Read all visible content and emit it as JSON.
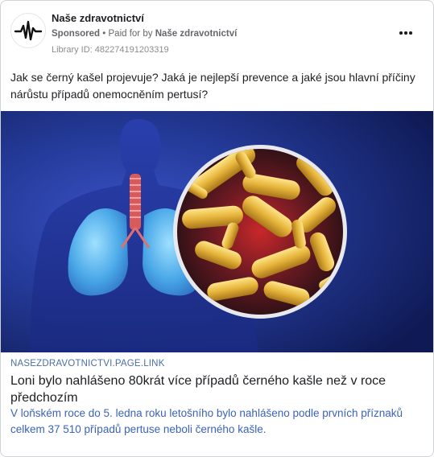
{
  "ad": {
    "page_name": "Naše zdravotnictví",
    "sponsored_label": "Sponsored",
    "separator": "•",
    "paid_for_by_label": "Paid for by",
    "paid_for_by_name": "Naše zdravotnictví",
    "library_id": "Library ID: 482274191203319",
    "more_options_icon": "more-horizontal-icon",
    "primary_text": "Jak se černý kašel projevuje? Jaká je nejlepší prevence a jaké jsou hlavní příčiny nárůstu případů onemocněním pertusí?",
    "image_alt": "Illustration of human lungs with bacteria under magnification",
    "link": {
      "domain": "NASEZDRAVOTNICTVI.PAGE.LINK",
      "headline": "Loni bylo nahlášeno 80krát více případů černého kašle než v roce předchozím",
      "description": "V loňském roce do 5. ledna roku letošního bylo nahlášeno podle prvních příznaků celkem 37 510 případů pertuse neboli černého kašle."
    }
  },
  "colors": {
    "text_primary": "#1c1e21",
    "text_secondary": "#65676b",
    "link_blue": "#3b63b8",
    "border": "#d0d2d6"
  }
}
